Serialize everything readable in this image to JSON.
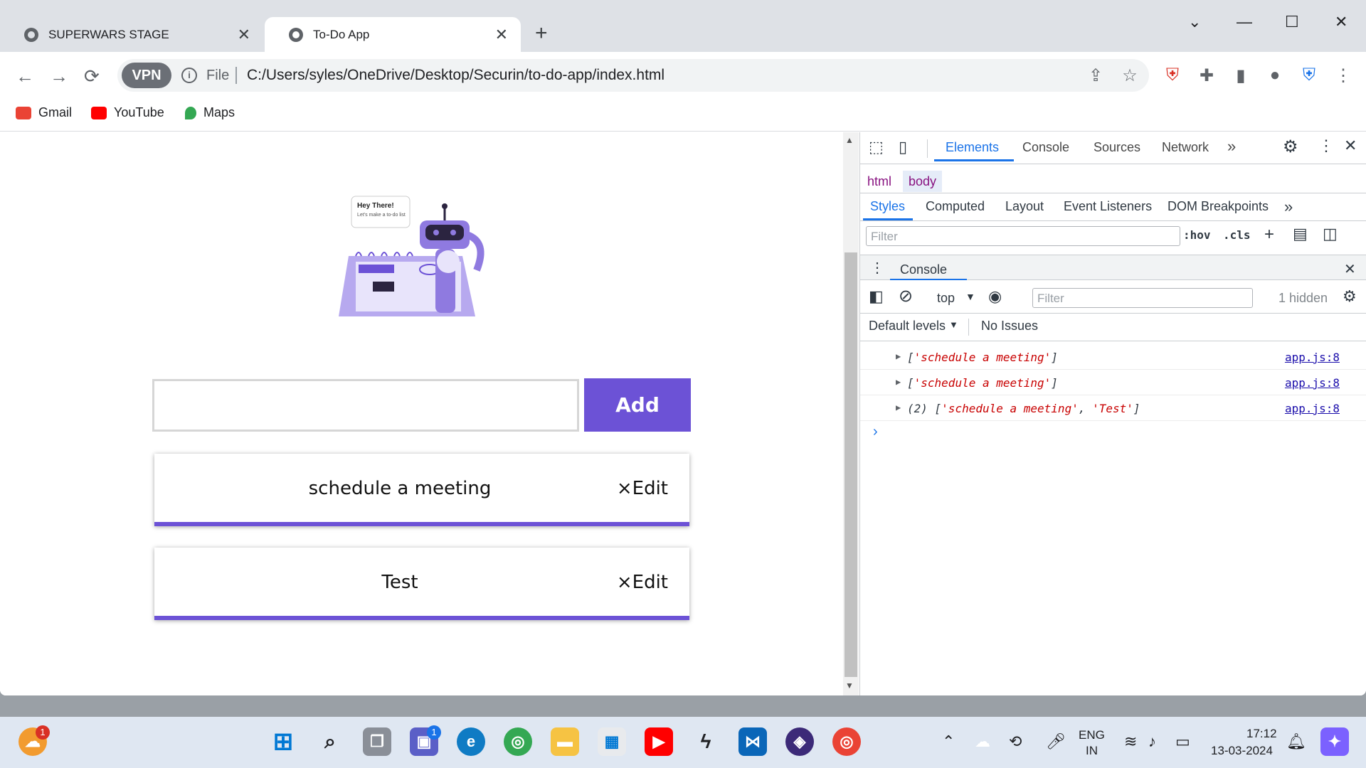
{
  "browser": {
    "tabs": [
      {
        "title": "SUPERWARS STAGE",
        "active": false
      },
      {
        "title": "To-Do App",
        "active": true
      }
    ],
    "new_tab_label": "+",
    "address": {
      "badge": "VPN",
      "scheme": "File",
      "url": "C:/Users/syles/OneDrive/Desktop/Securin/to-do-app/index.html"
    },
    "bookmarks": [
      {
        "label": "Gmail",
        "color": "#ea4335"
      },
      {
        "label": "YouTube",
        "color": "#ff0000"
      },
      {
        "label": "Maps",
        "color": "#34a853"
      }
    ]
  },
  "page": {
    "illustration": {
      "bubble_title": "Hey There!",
      "bubble_text": "Let's make a to-do list"
    },
    "input_value": "",
    "add_label": "Add",
    "todos": [
      {
        "text": "schedule a meeting",
        "actions": "×Edit"
      },
      {
        "text": "Test",
        "actions": "×Edit"
      }
    ],
    "accent_color": "#6c52d6"
  },
  "devtools": {
    "tabs": [
      "Elements",
      "Console",
      "Sources",
      "Network"
    ],
    "more_tabs": "»",
    "breadcrumbs": [
      "html",
      "body"
    ],
    "subtabs": [
      "Styles",
      "Computed",
      "Layout",
      "Event Listeners",
      "DOM Breakpoints"
    ],
    "styles_filter_placeholder": "Filter",
    "hov": ":hov",
    "cls": ".cls",
    "drawer_title": "Console",
    "context": "top",
    "console_filter_placeholder": "Filter",
    "hidden": "1 hidden",
    "levels": "Default levels",
    "issues": "No Issues",
    "logs": [
      {
        "prefix": "[",
        "parts": [
          "'schedule a meeting'"
        ],
        "suffix": "]",
        "source": "app.js:8"
      },
      {
        "prefix": "[",
        "parts": [
          "'schedule a meeting'"
        ],
        "suffix": "]",
        "source": "app.js:8"
      },
      {
        "prefix": "(2) [",
        "parts": [
          "'schedule a meeting'",
          "'Test'"
        ],
        "suffix": "]",
        "source": "app.js:8"
      }
    ],
    "prompt": "›"
  },
  "taskbar": {
    "lang_top": "ENG",
    "lang_bottom": "IN",
    "time": "17:12",
    "date": "13-03-2024",
    "badges": {
      "weather": "1",
      "teams": "1"
    }
  }
}
